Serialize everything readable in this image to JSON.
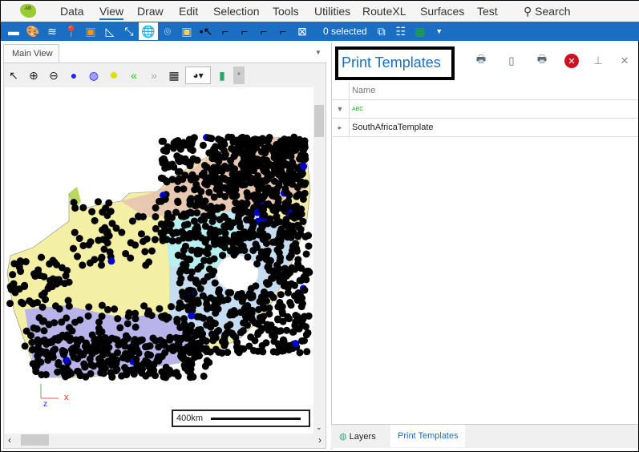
{
  "menubar": {
    "items": [
      "Data",
      "View",
      "Draw",
      "Edit",
      "Selection",
      "Tools",
      "Utilities",
      "RouteXL",
      "Surfaces",
      "Test"
    ],
    "active": "View",
    "search_label": "Search"
  },
  "toolbar": {
    "selection_count": "0 selected"
  },
  "left": {
    "tab_label": "Main View",
    "scale_label": "400km",
    "axis_x": "x",
    "axis_z": "z",
    "pin_label": "*"
  },
  "right": {
    "title": "Print Templates",
    "grid": {
      "column_header": "Name",
      "filter_glyph": "ABC",
      "rows": [
        "SouthAfricaTemplate"
      ]
    }
  },
  "bottom_tabs": {
    "layers": "Layers",
    "print_templates": "Print Templates",
    "active": "Print Templates"
  },
  "colors": {
    "accent": "#1a6fc2",
    "map_dots": "#000000"
  }
}
